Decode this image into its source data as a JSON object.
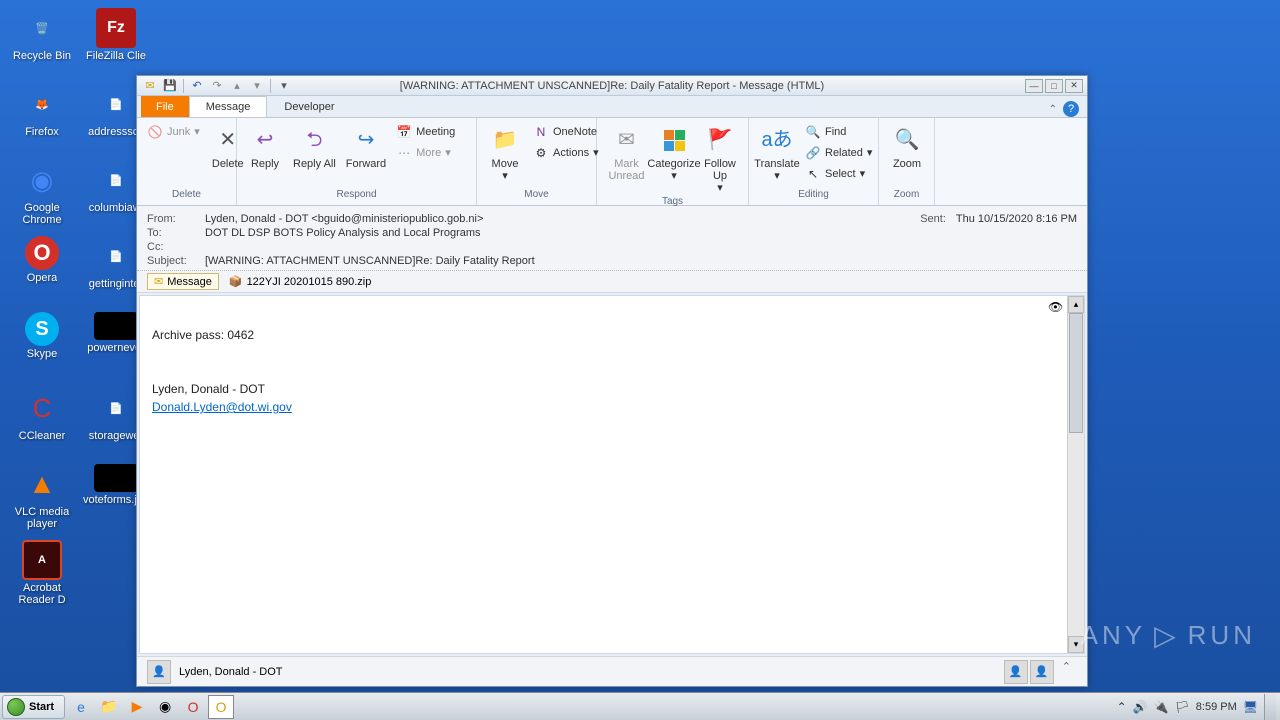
{
  "desktop": {
    "icons": [
      {
        "label": "Recycle Bin",
        "glyph": "🗑️",
        "bg": ""
      },
      {
        "label": "Acrobat Reader D",
        "glyph": "A",
        "bg": "#b01818"
      },
      {
        "label": "voteforms.jpg",
        "glyph": "▪",
        "bg": "#000"
      },
      {
        "label": "Firefox",
        "glyph": "🦊",
        "bg": ""
      },
      {
        "label": "FileZilla Clie",
        "glyph": "Fz",
        "bg": "#b01818"
      },
      {
        "label": "Google Chrome",
        "glyph": "◉",
        "bg": ""
      },
      {
        "label": "addresssci.",
        "glyph": "📄",
        "bg": ""
      },
      {
        "label": "Opera",
        "glyph": "O",
        "bg": "#d4302a"
      },
      {
        "label": "columbiawi",
        "glyph": "📄",
        "bg": ""
      },
      {
        "label": "Skype",
        "glyph": "S",
        "bg": "#00aff0"
      },
      {
        "label": "gettinginter",
        "glyph": "📄",
        "bg": ""
      },
      {
        "label": "CCleaner",
        "glyph": "🧹",
        "bg": ""
      },
      {
        "label": "powernever",
        "glyph": "▪",
        "bg": "#000"
      },
      {
        "label": "VLC media player",
        "glyph": "▲",
        "bg": "#f57c00"
      },
      {
        "label": "storagewer",
        "glyph": "📄",
        "bg": ""
      }
    ]
  },
  "window": {
    "title": "[WARNING: ATTACHMENT UNSCANNED]Re: Daily Fatality Report -  Message (HTML)",
    "tabs": {
      "file": "File",
      "message": "Message",
      "developer": "Developer"
    },
    "ribbon": {
      "delete": {
        "label": "Delete",
        "junk": "Junk",
        "del": "Delete"
      },
      "respond": {
        "label": "Respond",
        "reply": "Reply",
        "replyall": "Reply All",
        "forward": "Forward",
        "meeting": "Meeting",
        "more": "More"
      },
      "move": {
        "label": "Move",
        "move": "Move",
        "onenote": "OneNote",
        "actions": "Actions"
      },
      "tags": {
        "label": "Tags",
        "unread": "Mark Unread",
        "categorize": "Categorize",
        "followup": "Follow Up"
      },
      "editing": {
        "label": "Editing",
        "translate": "Translate",
        "find": "Find",
        "related": "Related",
        "select": "Select"
      },
      "zoom": {
        "label": "Zoom",
        "zoom": "Zoom"
      }
    },
    "headers": {
      "from_label": "From:",
      "from": "Lyden, Donald - DOT <bguido@ministeriopublico.gob.ni>",
      "to_label": "To:",
      "to": "DOT DL DSP BOTS Policy Analysis and Local Programs",
      "cc_label": "Cc:",
      "cc": "",
      "subject_label": "Subject:",
      "subject": "[WARNING: ATTACHMENT UNSCANNED]Re: Daily Fatality Report",
      "sent_label": "Sent:",
      "sent": "Thu 10/15/2020 8:16 PM"
    },
    "attachments": {
      "message_tab": "Message",
      "file": "122YJI 20201015 890.zip"
    },
    "body": {
      "line1": "Archive pass: 0462",
      "sig_name": "Lyden, Donald - DOT",
      "sig_email": "Donald.Lyden@dot.wi.gov"
    },
    "contact": "Lyden, Donald - DOT"
  },
  "taskbar": {
    "start": "Start",
    "time": "8:59 PM"
  },
  "watermark": {
    "left": "ANY",
    "right": "RUN"
  }
}
